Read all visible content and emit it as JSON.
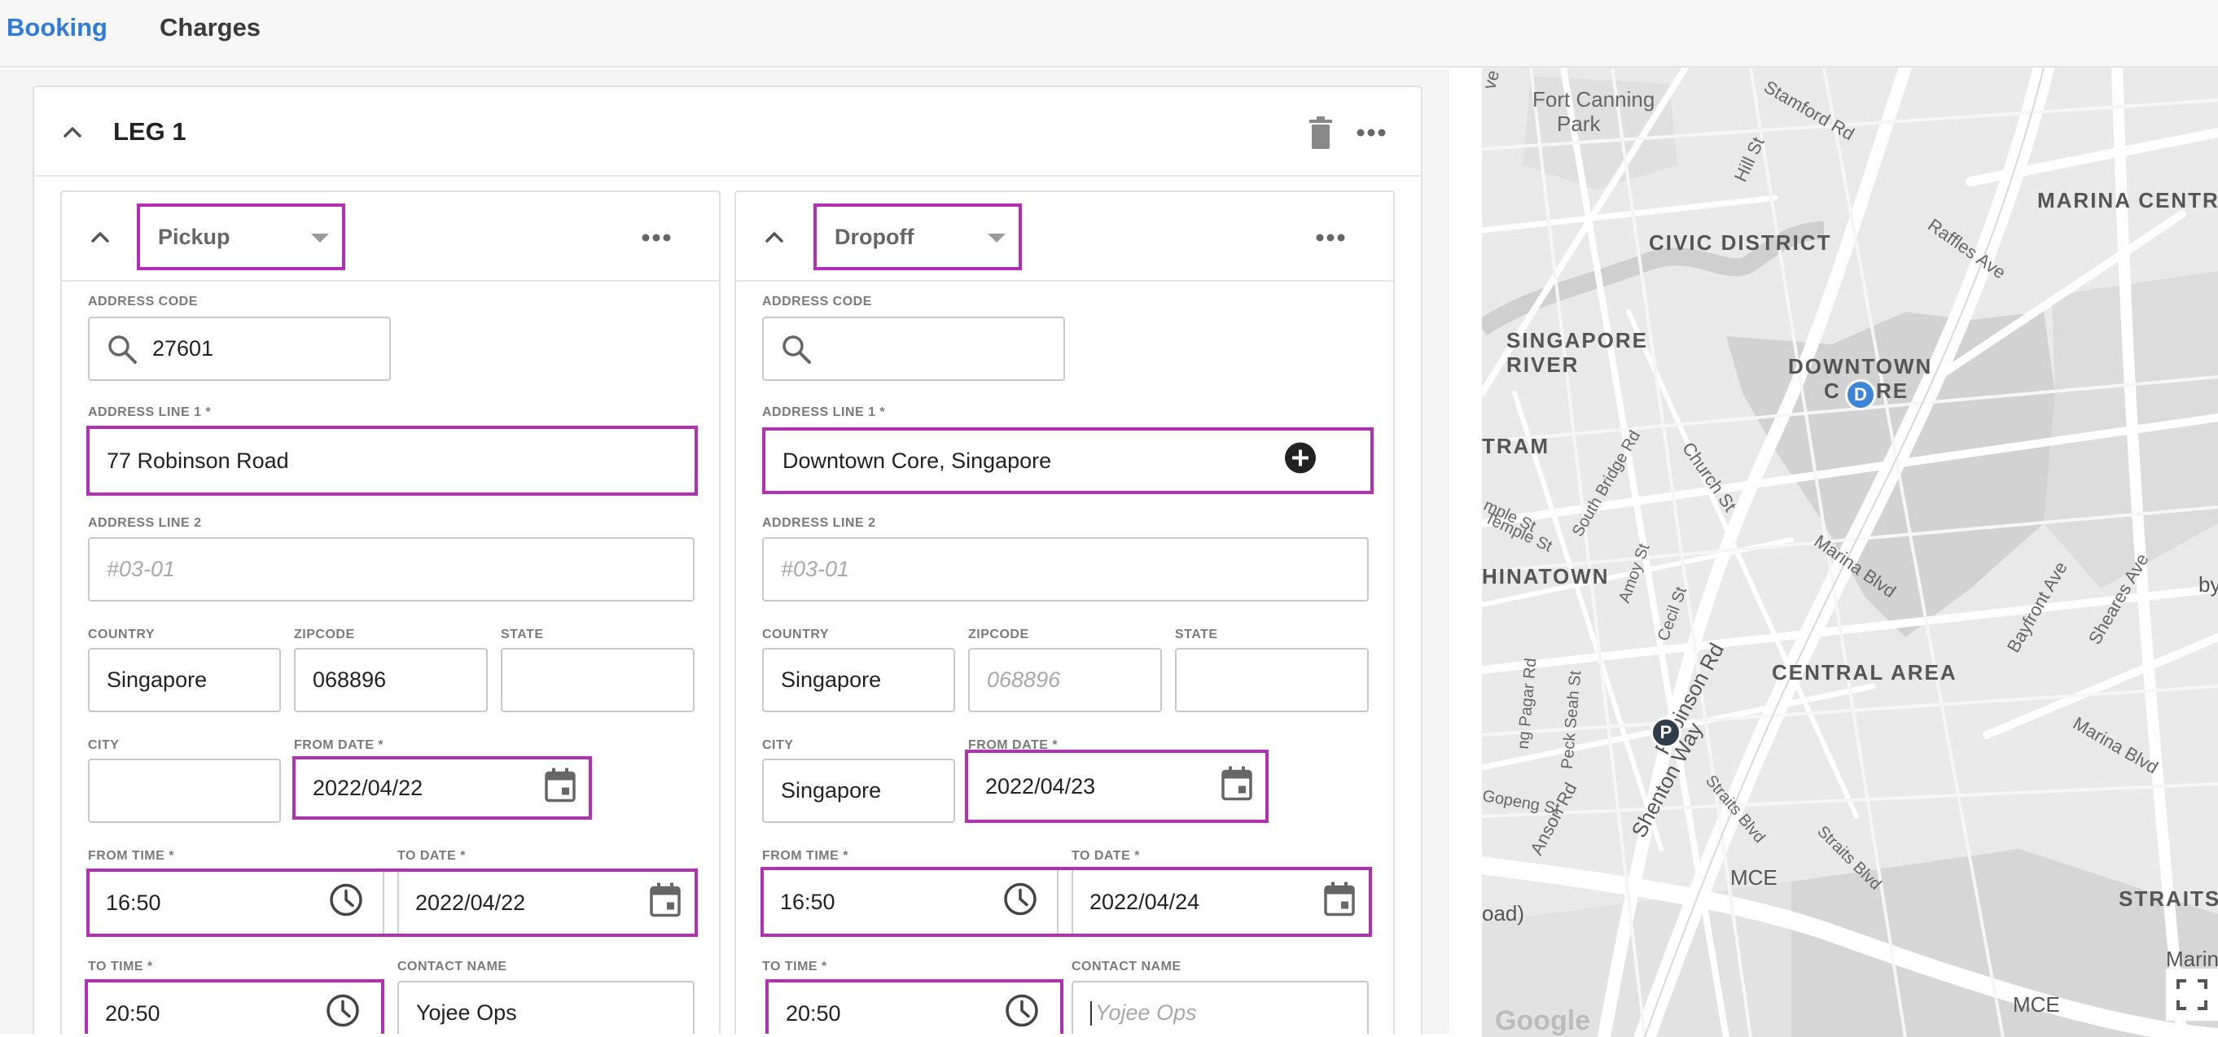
{
  "tabs": [
    {
      "label": "Booking",
      "active": true
    },
    {
      "label": "Charges",
      "active": false
    }
  ],
  "leg": {
    "title": "LEG 1"
  },
  "pickup": {
    "type": "Pickup",
    "address_code_label": "ADDRESS CODE",
    "address_code": "27601",
    "address_line1_label": "ADDRESS LINE 1 *",
    "address_line1": "77 Robinson Road",
    "address_line2_label": "ADDRESS LINE 2",
    "address_line2_placeholder": "#03-01",
    "country_label": "COUNTRY",
    "country": "Singapore",
    "zipcode_label": "ZIPCODE",
    "zipcode": "068896",
    "state_label": "STATE",
    "city_label": "CITY",
    "city": "",
    "from_date_label": "FROM DATE *",
    "from_date": "2022/04/22",
    "from_time_label": "FROM TIME *",
    "from_time": "16:50",
    "to_date_label": "TO DATE *",
    "to_date": "2022/04/22",
    "to_time_label": "TO TIME *",
    "to_time": "20:50",
    "contact_name_label": "CONTACT NAME",
    "contact_name": "Yojee Ops"
  },
  "dropoff": {
    "type": "Dropoff",
    "address_code_label": "ADDRESS CODE",
    "address_code": "",
    "address_line1_label": "ADDRESS LINE 1 *",
    "address_line1": "Downtown Core, Singapore",
    "address_line2_label": "ADDRESS LINE 2",
    "address_line2_placeholder": "#03-01",
    "country_label": "COUNTRY",
    "country": "Singapore",
    "zipcode_label": "ZIPCODE",
    "zipcode_placeholder": "068896",
    "state_label": "STATE",
    "city_label": "CITY",
    "city": "Singapore",
    "from_date_label": "FROM DATE *",
    "from_date": "2022/04/23",
    "from_time_label": "FROM TIME *",
    "from_time": "16:50",
    "to_date_label": "TO DATE *",
    "to_date": "2022/04/24",
    "to_time_label": "TO TIME *",
    "to_time": "20:50",
    "contact_name_label": "CONTACT NAME",
    "contact_name_placeholder": "Yojee Ops"
  },
  "map": {
    "area_labels": [
      "Fort Canning",
      "Park",
      "CIVIC DISTRICT",
      "MARINA CENTR",
      "SINGAPORE",
      "RIVER",
      "DOWNTOWN",
      "C",
      "RE",
      "TRAM",
      "HINATOWN",
      "CENTRAL AREA",
      "STRAITS"
    ],
    "street_labels": [
      "Stamford Rd",
      "Hill St",
      "Raffles Ave",
      "South Bridge Rd",
      "Church St",
      "Temple St",
      "Amoy St",
      "Cecil St",
      "Robinson Rd",
      "Shenton Way",
      "Marina Blvd",
      "Bayfront Ave",
      "Sheares Ave",
      "Marina Blvd",
      "Anson Rd",
      "Straits Blvd",
      "Straits Blvd",
      "Peck Seah St",
      "Gopeng St",
      "MCE",
      "MCE",
      "oad)",
      "Marin",
      "ve",
      "by",
      "mple St",
      "ng Pagar Rd"
    ],
    "pins": [
      {
        "label": "D"
      },
      {
        "label": "P"
      }
    ],
    "attribution": "Google",
    "colors": {
      "pin_d": "#3d85d6",
      "pin_p": "#2f3c4a",
      "highlight": "#b32fb3",
      "tab_active": "#2f7bd9"
    }
  }
}
